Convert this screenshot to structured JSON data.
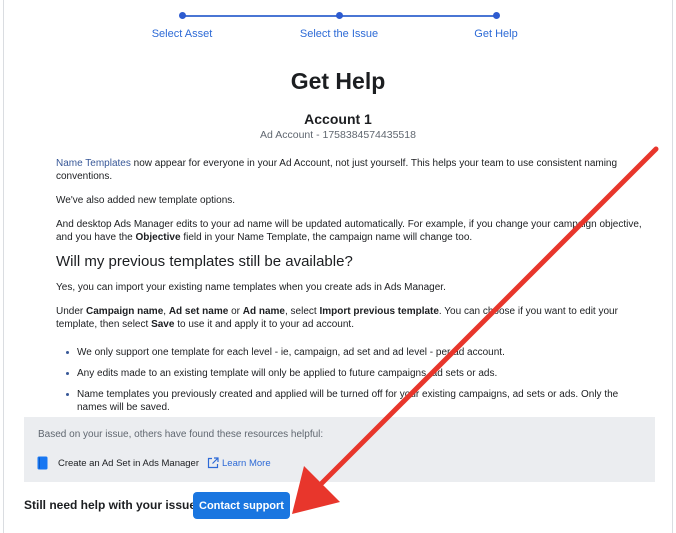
{
  "stepper": {
    "steps": [
      {
        "label": "Select Asset"
      },
      {
        "label": "Select the Issue"
      },
      {
        "label": "Get Help"
      }
    ]
  },
  "page": {
    "title": "Get Help",
    "account_name": "Account 1",
    "account_id": "Ad Account - 1758384574435518"
  },
  "article": {
    "p1_link": "Name Templates",
    "p1_rest": " now appear for everyone in your Ad Account, not just yourself. This helps your team to use consistent naming conventions.",
    "p2": "We've also added new template options.",
    "p3_a": "And desktop Ads Manager edits to your ad name will be updated automatically. For example, if you change your campaign objective, and you have the ",
    "p3_bold": "Objective",
    "p3_b": " field in your Name Template, the campaign name will change too.",
    "heading": "Will my previous templates still be available?",
    "p4": "Yes, you can import your existing name templates when you create ads in Ads Manager.",
    "p5_a": "Under ",
    "p5_b1": "Campaign name",
    "p5_c": ", ",
    "p5_b2": "Ad set name",
    "p5_d": " or ",
    "p5_b3": "Ad name",
    "p5_e": ", select ",
    "p5_b4": "Import previous template",
    "p5_f": ". You can choose if you want to edit your template, then select ",
    "p5_b5": "Save",
    "p5_g": " to use it and apply it to your ad account.",
    "bullets": [
      "We only support one template for each level - ie, campaign, ad set and ad level - per ad account.",
      "Any edits made to an existing template will only be applied to future campaigns, ad sets or ads.",
      "Name templates you previously created and applied will be turned off for your existing campaigns, ad sets or ads. Only the names will be saved."
    ]
  },
  "resources": {
    "intro": "Based on your issue, others have found these resources helpful:",
    "item_icon": "book-icon",
    "item_title": "Create an Ad Set in Ads Manager",
    "link_icon": "external-link-icon",
    "link_label": "Learn More"
  },
  "footer": {
    "question": "Still need help with your issue?",
    "button_label": "Contact support"
  },
  "colors": {
    "accent": "#1a76e0",
    "link": "#385898",
    "annotation_arrow": "#e8362c"
  }
}
